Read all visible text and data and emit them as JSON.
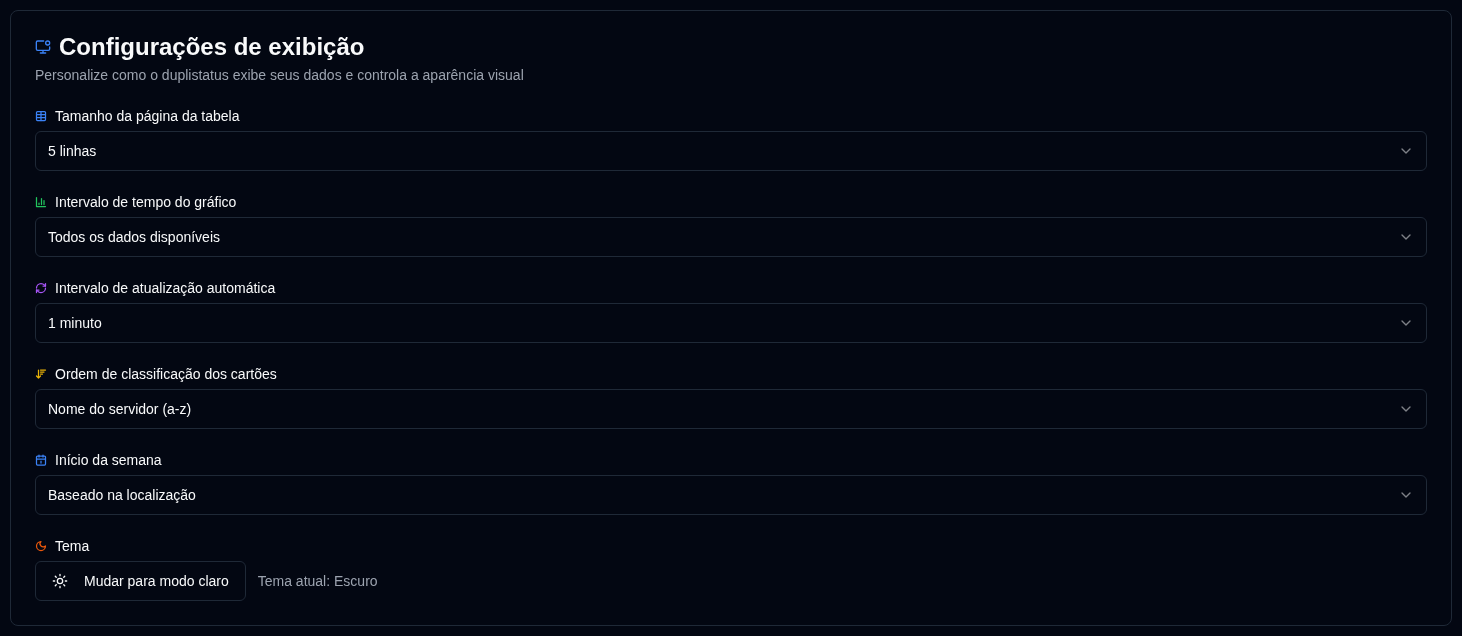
{
  "card": {
    "title": "Configurações de exibição",
    "subtitle": "Personalize como o duplistatus exibe seus dados e controla a aparência visual"
  },
  "selects": [
    {
      "label": "Tamanho da página da tabela",
      "value": "5 linhas"
    },
    {
      "label": "Intervalo de tempo do gráfico",
      "value": "Todos os dados disponíveis"
    },
    {
      "label": "Intervalo de atualização automática",
      "value": "1 minuto"
    },
    {
      "label": "Ordem de classificação dos cartões",
      "value": "Nome do servidor (a-z)"
    },
    {
      "label": "Início da semana",
      "value": "Baseado na localização"
    }
  ],
  "theme": {
    "label": "Tema",
    "button": "Mudar para modo claro",
    "status": "Tema atual: Escuro"
  }
}
